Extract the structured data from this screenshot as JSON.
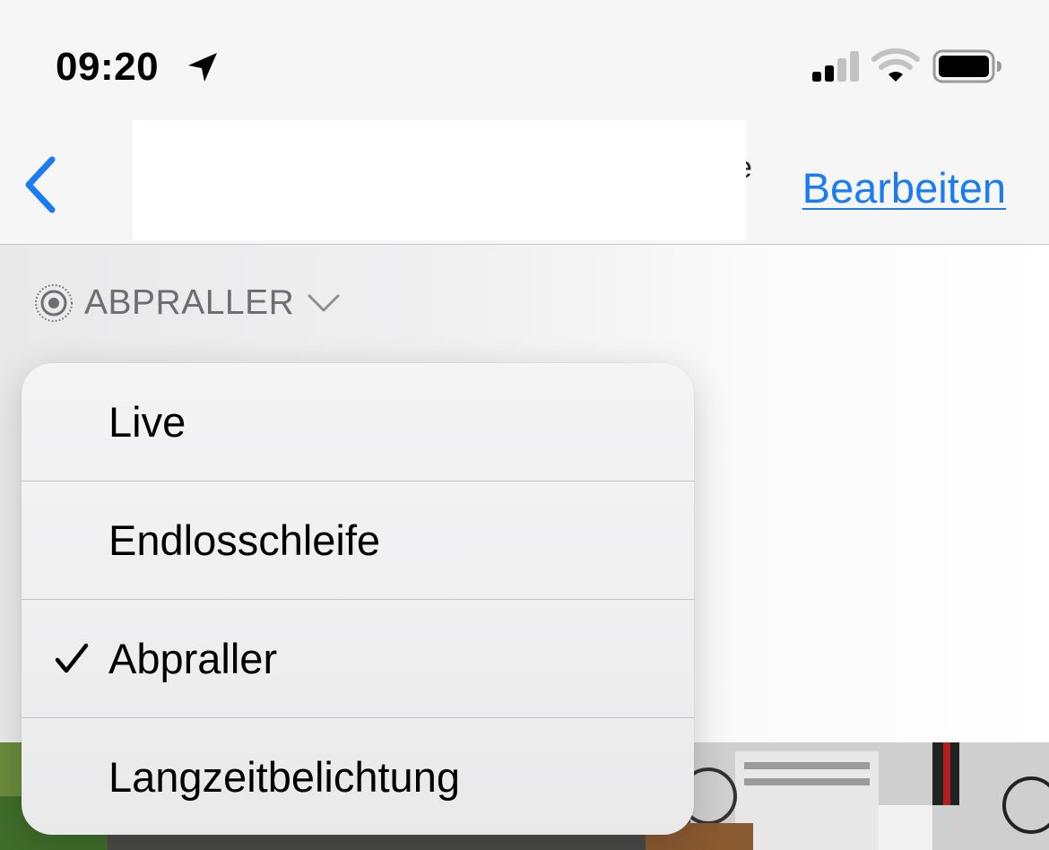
{
  "status_bar": {
    "time": "09:20",
    "icons": [
      "location-arrow-icon",
      "cellular-signal-icon",
      "wifi-icon",
      "battery-icon"
    ]
  },
  "nav": {
    "back_icon": "chevron-left-icon",
    "title_fragment": "e",
    "edit_label": "Bearbeiten"
  },
  "effect_selector": {
    "icon": "live-photo-icon",
    "label": "ABPRALLER",
    "chevron": "chevron-down-icon"
  },
  "menu": {
    "items": [
      {
        "label": "Live",
        "selected": false
      },
      {
        "label": "Endlosschleife",
        "selected": false
      },
      {
        "label": "Abpraller",
        "selected": true
      },
      {
        "label": "Langzeitbelichtung",
        "selected": false
      }
    ]
  },
  "colors": {
    "accent": "#1a7cf0",
    "label_gray": "#6d6d72",
    "menu_bg": "#f1f1f2",
    "separator": "#c4c4c6"
  }
}
